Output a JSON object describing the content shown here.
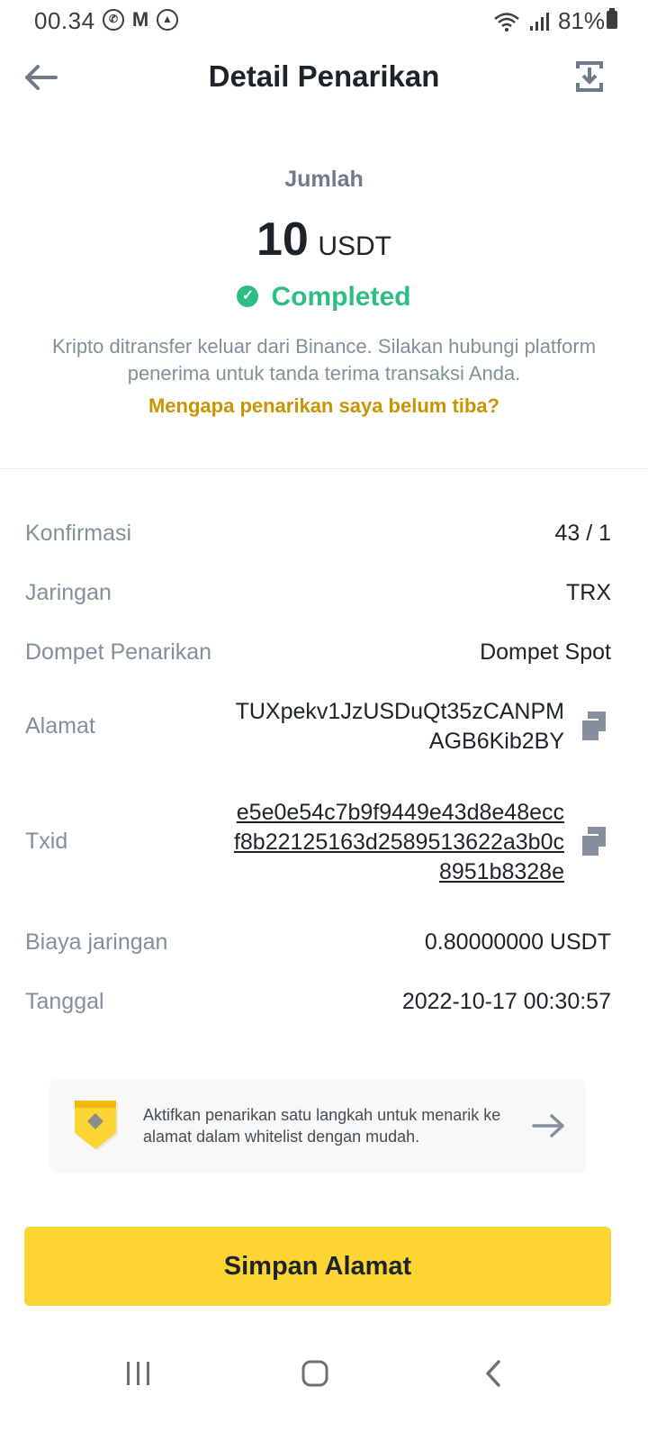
{
  "status_bar": {
    "time": "00.34",
    "battery": "81%",
    "icons": [
      "whatsapp-icon",
      "gmail-icon",
      "app-icon",
      "wifi-icon",
      "signal-icon",
      "battery-icon"
    ]
  },
  "header": {
    "title": "Detail Penarikan",
    "back_icon": "arrow-left-icon",
    "download_icon": "download-icon"
  },
  "summary": {
    "amount_label": "Jumlah",
    "amount_value": "10",
    "amount_unit": "USDT",
    "status": "Completed",
    "description": "Kripto ditransfer keluar dari Binance. Silakan hubungi platform penerima untuk tanda terima transaksi Anda.",
    "help_link": "Mengapa penarikan saya belum tiba?"
  },
  "details": {
    "confirmation": {
      "label": "Konfirmasi",
      "value": "43 / 1"
    },
    "network": {
      "label": "Jaringan",
      "value": "TRX"
    },
    "wallet": {
      "label": "Dompet Penarikan",
      "value": "Dompet Spot"
    },
    "address": {
      "label": "Alamat",
      "line1": "TUXpekv1JzUSDuQt35zCANPM",
      "line2": "AGB6Kib2BY"
    },
    "txid": {
      "label": "Txid",
      "line1": "e5e0e54c7b9f9449e43d8e48ecc",
      "line2": "f8b22125163d2589513622a3b0c",
      "line3": "8951b8328e"
    },
    "fee": {
      "label": "Biaya jaringan",
      "value": "0.80000000 USDT"
    },
    "date": {
      "label": "Tanggal",
      "value": "2022-10-17 00:30:57"
    }
  },
  "promo": {
    "text": "Aktifkan penarikan satu langkah untuk menarik ke alamat dalam whitelist dengan mudah."
  },
  "save_button": "Simpan Alamat",
  "colors": {
    "accent": "#fcd535",
    "success": "#2ebd85",
    "link": "#c99400",
    "label": "#848e9c",
    "text": "#1e2329"
  }
}
